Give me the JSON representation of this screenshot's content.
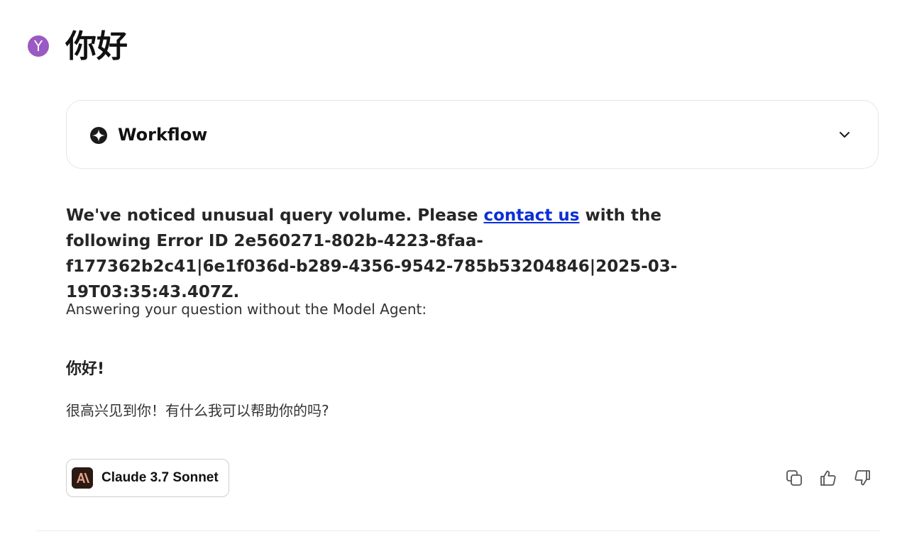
{
  "user": {
    "avatar_letter": "Y",
    "avatar_color": "#9b59c4"
  },
  "message": {
    "title": "你好"
  },
  "workflow": {
    "label": "Workflow",
    "icon": "sparkle-icon",
    "toggle_icon": "chevron-down-icon"
  },
  "error": {
    "text_before": "We've noticed unusual query volume. Please ",
    "link_text": "contact us",
    "text_after": " with the following Error ID 2e560271-802b-4223-8faa-f177362b2c41|6e1f036d-b289-4356-9542-785b53204846|2025-03-19T03:35:43.407Z."
  },
  "answer": {
    "note": "Answering your question without the Model Agent:",
    "greeting": "你好!",
    "reply": "很高兴见到你！有什么我可以帮助你的吗?"
  },
  "model": {
    "label": "Claude 3.7 Sonnet",
    "logo": "anthropic-logo"
  },
  "actions": [
    {
      "name": "copy-icon"
    },
    {
      "name": "thumbs-up-icon"
    },
    {
      "name": "thumbs-down-icon"
    }
  ],
  "colors": {
    "accent_link": "#0b2fd6",
    "model_logo_bg": "#2b1a14",
    "model_logo_fg": "#e8a58a"
  }
}
